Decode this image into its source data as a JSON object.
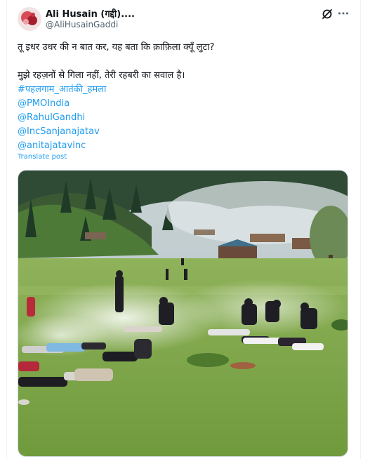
{
  "post": {
    "author_name": "Ali Husain (गद्दी)....",
    "author_handle": "@AliHusainGaddi",
    "text_lines": [
      "तू इधर उधर की न बात कर, यह बता कि क़ाफ़िला क्यूँ लुटा?",
      "मुझे रहज़नों से गिला नहीं, तेरी रहबरी का सवाल है।"
    ],
    "hashtag": "#पहलगाम_आतंकी_हमला",
    "mentions": [
      "@PMOIndia",
      "@RahulGandhi",
      "@IncSanjanajatav",
      "@anitajatavinc"
    ],
    "translate_label": "Translate post"
  },
  "icons": {
    "grok": "grok-icon",
    "more": "more-icon",
    "avatar": "avatar"
  },
  "colors": {
    "link": "#1d9bf0",
    "secondary_text": "#536471",
    "primary_text": "#0f1419",
    "border": "#cfd9de"
  }
}
